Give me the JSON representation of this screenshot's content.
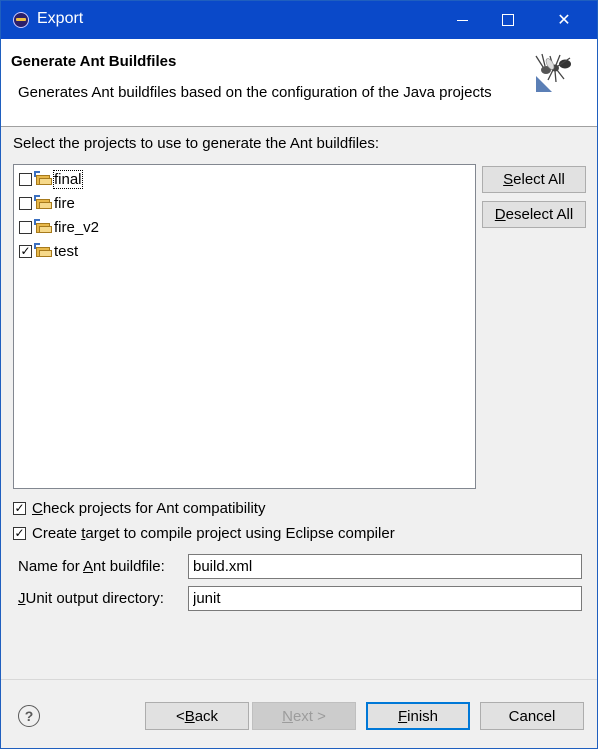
{
  "window": {
    "title": "Export",
    "controls": {
      "minimize_icon": "minimize-icon",
      "maximize_icon": "maximize-icon",
      "close_icon": "close-icon",
      "close_glyph": "✕"
    }
  },
  "header": {
    "title": "Generate Ant Buildfiles",
    "description": "Generates Ant buildfiles based on the configuration of the Java projects",
    "icon": "ant-icon"
  },
  "projects": {
    "label": "Select the projects to use to generate the Ant buildfiles:",
    "items": [
      {
        "name": "final",
        "checked": false,
        "focused": true
      },
      {
        "name": "fire",
        "checked": false,
        "focused": false
      },
      {
        "name": "fire_v2",
        "checked": false,
        "focused": false
      },
      {
        "name": "test",
        "checked": true,
        "focused": false
      }
    ],
    "check_glyph": "✓",
    "select_all": {
      "pre": "",
      "mnemonic": "S",
      "post": "elect All"
    },
    "deselect_all": {
      "pre": "",
      "mnemonic": "D",
      "post": "eselect All"
    }
  },
  "options": {
    "check_compat": {
      "pre": "",
      "mnemonic": "C",
      "post": "heck projects for Ant compatibility",
      "checked": true
    },
    "create_target": {
      "pre": "Create ",
      "mnemonic": "t",
      "post": "arget to compile project using Eclipse compiler",
      "checked": true
    }
  },
  "fields": {
    "buildfile": {
      "pre": "Name for ",
      "mnemonic": "A",
      "post": "nt buildfile:",
      "value": "build.xml"
    },
    "junit": {
      "pre": "",
      "mnemonic": "J",
      "post": "Unit output directory:",
      "value": "junit"
    }
  },
  "footer": {
    "help_glyph": "?",
    "back": {
      "pre": "< ",
      "mnemonic": "B",
      "post": "ack"
    },
    "next": {
      "pre": "",
      "mnemonic": "N",
      "post": "ext >"
    },
    "finish": {
      "pre": "",
      "mnemonic": "F",
      "post": "inish"
    },
    "cancel": "Cancel"
  },
  "colors": {
    "titlebar": "#0a49c9",
    "dialog_bg": "#f0f0f0",
    "primary_border": "#0078d7"
  }
}
